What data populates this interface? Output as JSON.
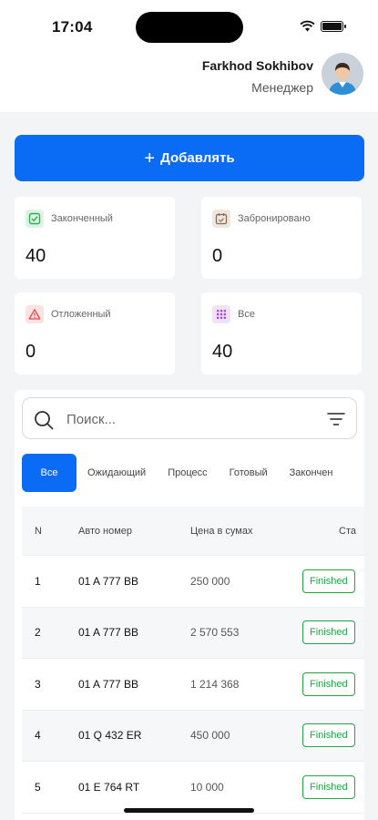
{
  "status_bar": {
    "time": "17:04"
  },
  "user": {
    "name": "Farkhod Sokhibov",
    "role": "Менеджер"
  },
  "add_button": {
    "icon": "+",
    "label": "Добавлять"
  },
  "stats": [
    {
      "label": "Законченный",
      "value": "40",
      "icon": "check-square-icon",
      "color": "#2fae53"
    },
    {
      "label": "Забронировано",
      "value": "0",
      "icon": "calendar-icon",
      "color": "#8a6d55"
    },
    {
      "label": "Отложенный",
      "value": "0",
      "icon": "warning-triangle-icon",
      "color": "#e5484d"
    },
    {
      "label": "Все",
      "value": "40",
      "icon": "grid-icon",
      "color": "#a54fd6"
    }
  ],
  "search": {
    "placeholder": "Поиск..."
  },
  "tabs": [
    "Все",
    "Ожидающий",
    "Процесс",
    "Готовый",
    "Закончен"
  ],
  "table": {
    "headers": {
      "n": "N",
      "car": "Авто номер",
      "price": "Цена в сумах",
      "status": "Ста"
    },
    "rows": [
      {
        "n": "1",
        "car": "01 A 777 BB",
        "price": "250 000",
        "status": "Finished"
      },
      {
        "n": "2",
        "car": "01 A 777 BB",
        "price": "2 570 553",
        "status": "Finished"
      },
      {
        "n": "3",
        "car": "01 A 777 BB",
        "price": "1 214 368",
        "status": "Finished"
      },
      {
        "n": "4",
        "car": "01 Q 432 ER",
        "price": "450 000",
        "status": "Finished"
      },
      {
        "n": "5",
        "car": "01 E 764 RT",
        "price": "10 000",
        "status": "Finished"
      }
    ]
  },
  "colors": {
    "primary": "#0a6cf5",
    "finished": "#22a447"
  }
}
